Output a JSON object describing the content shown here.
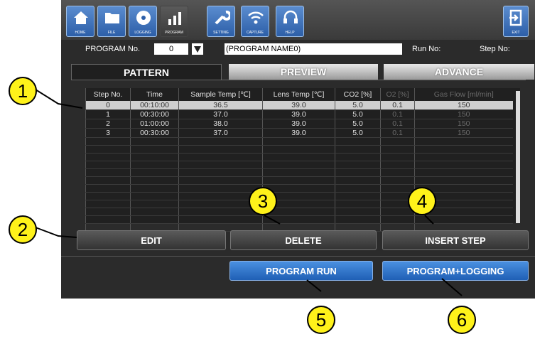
{
  "toolbar": {
    "buttons": [
      {
        "label": "HOME",
        "icon": "home-icon"
      },
      {
        "label": "FILE",
        "icon": "folder-icon"
      },
      {
        "label": "LOGGING",
        "icon": "disc-icon"
      },
      {
        "label": "PROGRAM",
        "icon": "chart-icon"
      },
      {
        "label": "SETTING",
        "icon": "wrench-icon"
      },
      {
        "label": "CAPTURE",
        "icon": "wifi-icon"
      },
      {
        "label": "HELP",
        "icon": "headset-icon"
      }
    ],
    "exit_label": "EXIT"
  },
  "program": {
    "no_label": "PROGRAM No.",
    "no_value": "0",
    "name_value": "(PROGRAM NAME0)",
    "run_label": "Run No:",
    "step_label": "Step No:"
  },
  "tabs": [
    "PATTERN",
    "PREVIEW",
    "ADVANCE"
  ],
  "table": {
    "headers": [
      "Step No.",
      "Time",
      "Sample Temp [℃]",
      "Lens Temp [℃]",
      "CO2 [%]",
      "O2 [%]",
      "Gas Flow [ml/min]"
    ],
    "rows": [
      [
        "0",
        "00:10:00",
        "36.5",
        "39.0",
        "5.0",
        "0.1",
        "150"
      ],
      [
        "1",
        "00:30:00",
        "37.0",
        "39.0",
        "5.0",
        "0.1",
        "150"
      ],
      [
        "2",
        "01:00:00",
        "38.0",
        "39.0",
        "5.0",
        "0.1",
        "150"
      ],
      [
        "3",
        "00:30:00",
        "37.0",
        "39.0",
        "5.0",
        "0.1",
        "150"
      ]
    ]
  },
  "buttons": {
    "edit": "EDIT",
    "delete": "DELETE",
    "insert": "INSERT STEP",
    "run": "PROGRAM RUN",
    "run_logging": "PROGRAM+LOGGING"
  },
  "callouts": [
    "1",
    "2",
    "3",
    "4",
    "5",
    "6"
  ]
}
